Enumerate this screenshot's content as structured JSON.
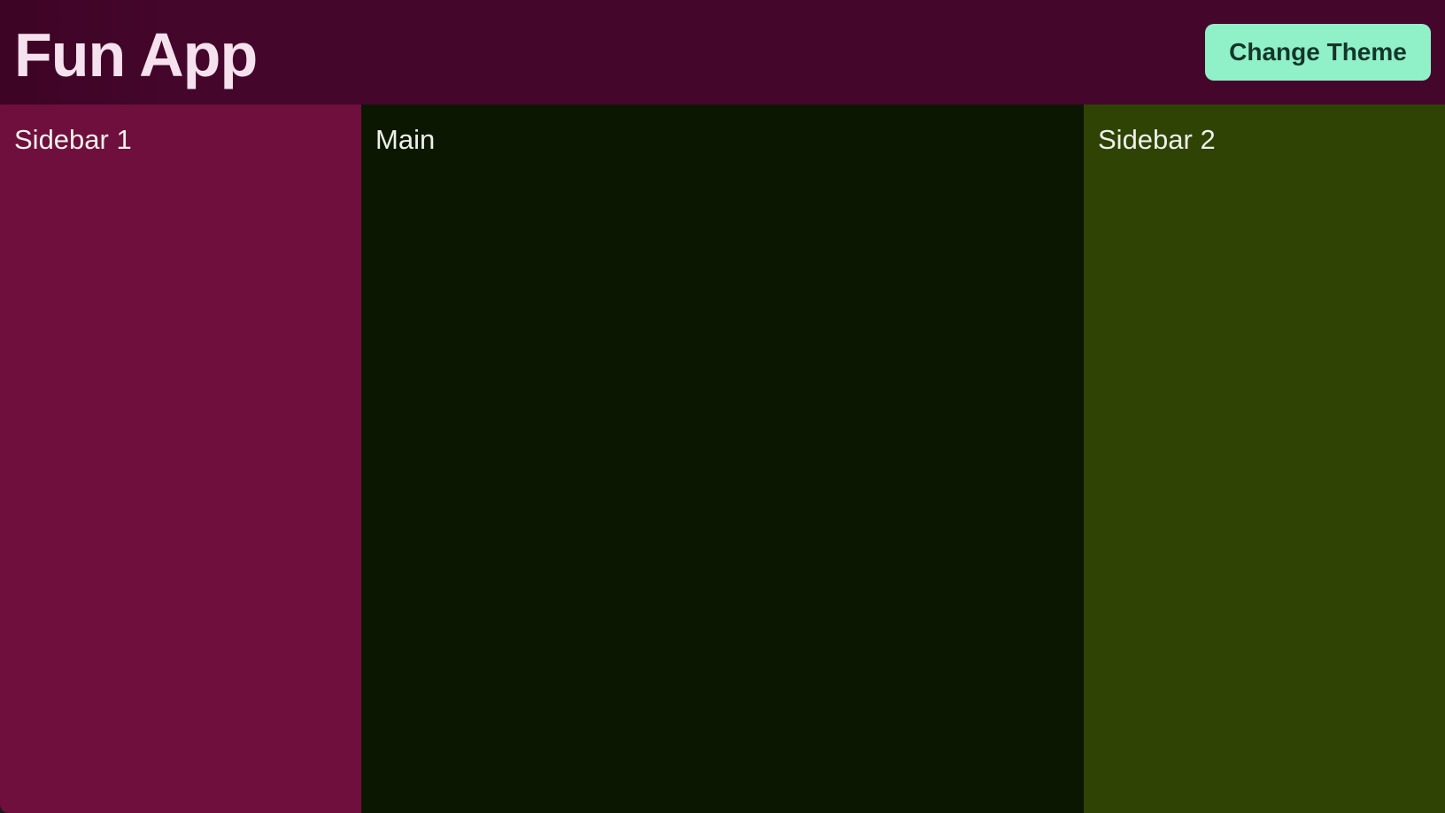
{
  "header": {
    "title": "Fun App",
    "change_theme_label": "Change Theme"
  },
  "panels": {
    "sidebar1_title": "Sidebar 1",
    "main_title": "Main",
    "sidebar2_title": "Sidebar 2"
  },
  "colors": {
    "header_bg": "#44062b",
    "title_text": "#f6e2ee",
    "button_bg": "#90f0c8",
    "button_text": "#14362a",
    "sidebar1_bg": "#6e0f3d",
    "main_bg": "#0c1701",
    "sidebar2_bg": "#2e4304",
    "panel_text": "#eef0ea"
  }
}
